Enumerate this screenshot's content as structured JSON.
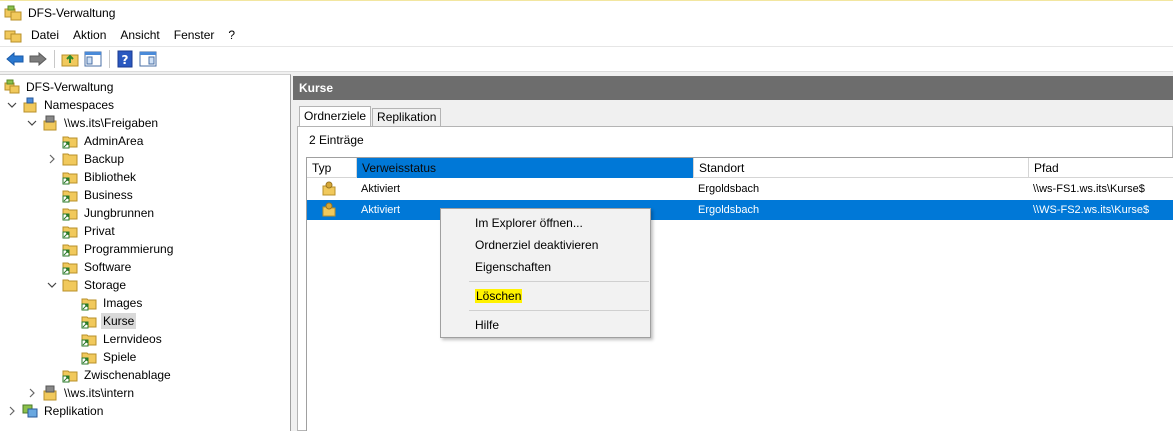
{
  "window": {
    "title": "DFS-Verwaltung"
  },
  "menu": [
    "Datei",
    "Aktion",
    "Ansicht",
    "Fenster",
    "?"
  ],
  "tree": {
    "root": "DFS-Verwaltung",
    "namespaces": "Namespaces",
    "freigaben": "\\\\ws.its\\Freigaben",
    "items": [
      "AdminArea",
      "Backup",
      "Bibliothek",
      "Business",
      "Jungbrunnen",
      "Privat",
      "Programmierung",
      "Software"
    ],
    "storage": "Storage",
    "storage_items": [
      "Images",
      "Kurse",
      "Lernvideos",
      "Spiele"
    ],
    "zwischenablage": "Zwischenablage",
    "intern": "\\\\ws.its\\intern",
    "replikation": "Replikation"
  },
  "detail": {
    "title": "Kurse",
    "tabs": [
      "Ordnerziele",
      "Replikation"
    ],
    "entry_count": "2 Einträge",
    "columns": [
      "Typ",
      "Verweisstatus",
      "Standort",
      "Pfad"
    ],
    "rows": [
      {
        "status": "Aktiviert",
        "location": "Ergoldsbach",
        "path": "\\\\ws-FS1.ws.its\\Kurse$"
      },
      {
        "status": "Aktiviert",
        "location": "Ergoldsbach",
        "path": "\\\\WS-FS2.ws.its\\Kurse$"
      }
    ]
  },
  "context_menu": {
    "items": [
      "Im Explorer öffnen...",
      "Ordnerziel deaktivieren",
      "Eigenschaften",
      "Löschen",
      "Hilfe"
    ]
  },
  "colors": {
    "selection": "#0078d7",
    "header": "#6d6d6d",
    "highlight": "#fff200",
    "folder": "#f1c95c"
  }
}
